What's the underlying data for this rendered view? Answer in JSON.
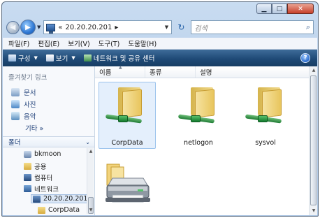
{
  "window": {
    "caption": {
      "minimize": "▁",
      "maximize": "□",
      "close": "✕"
    }
  },
  "nav": {
    "back_glyph": "◀",
    "forward_glyph": "▶",
    "address": {
      "prefix": "«",
      "path": "20.20.20.201",
      "separator": "▸"
    },
    "search_placeholder": "검색",
    "refresh_glyph": "↻",
    "search_glyph": "⌕"
  },
  "menu": [
    "파일(F)",
    "편집(E)",
    "보기(V)",
    "도구(T)",
    "도움말(H)"
  ],
  "commands": {
    "organize": "구성",
    "views": "보기",
    "network": "네트워크 및 공유 센터",
    "help": "?"
  },
  "favorites": {
    "title": "즐겨찾기 링크",
    "items": [
      "문서",
      "사진",
      "음악"
    ],
    "more": "기타 »"
  },
  "folders": {
    "header": "폴더",
    "tree": [
      "bkmoon",
      "공용",
      "컴퓨터",
      "네트워크",
      "20.20.20.201",
      "CorpData"
    ]
  },
  "columns": {
    "name": "이름",
    "type": "종류",
    "description": "설명"
  },
  "items": [
    {
      "label": "CorpData",
      "kind": "shared-folder",
      "selected": true
    },
    {
      "label": "netlogon",
      "kind": "shared-folder",
      "selected": false
    },
    {
      "label": "sysvol",
      "kind": "shared-folder",
      "selected": false
    },
    {
      "label": "",
      "kind": "printer",
      "selected": false
    }
  ],
  "colors": {
    "command_bar": "#1f4a77",
    "window_frame": "#b8cfe9",
    "selection": "#cde2fa"
  }
}
